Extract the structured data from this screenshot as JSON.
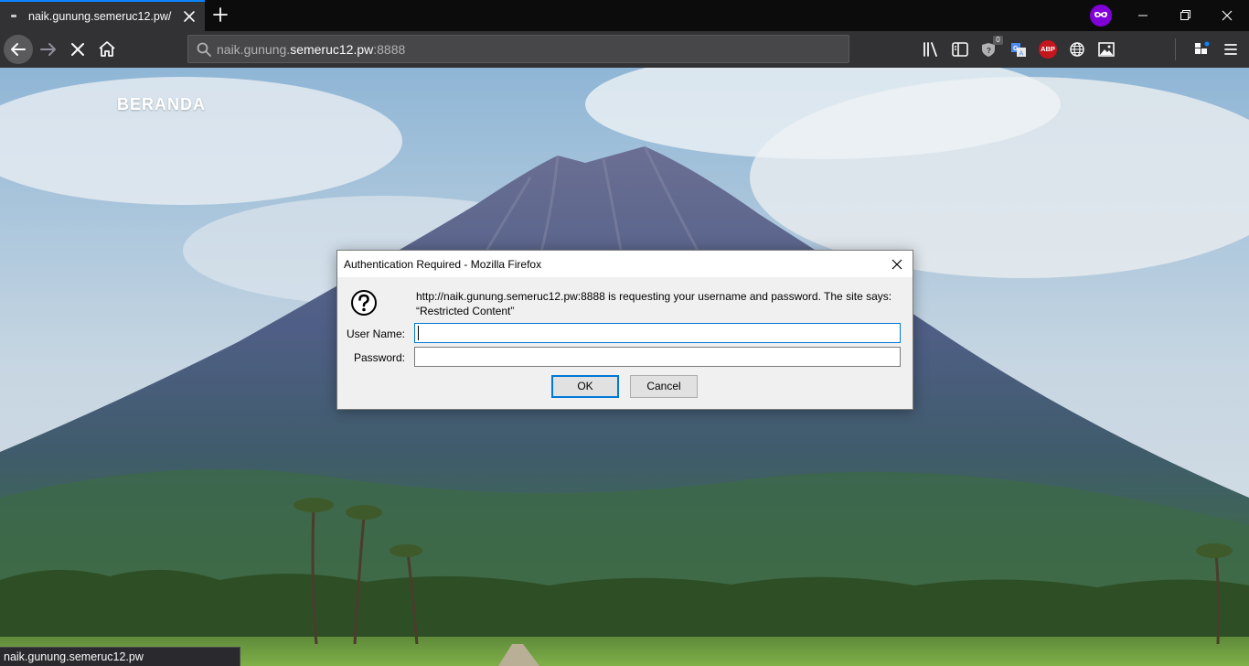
{
  "browser": {
    "tab_title": "naik.gunung.semeruc12.pw/",
    "url_prefix": "naik.gunung.",
    "url_domain": "semeruc12.pw",
    "url_port": ":8888",
    "shield_badge": "0",
    "abp_label": "ABP",
    "accent_color": "#0a84ff",
    "private_color": "#8000d7"
  },
  "page": {
    "nav_label": "BERANDA"
  },
  "status": {
    "text": "naik.gunung.semeruc12.pw"
  },
  "dialog": {
    "title": "Authentication Required - Mozilla Firefox",
    "message": "http://naik.gunung.semeruc12.pw:8888 is requesting your username and password. The site says: “Restricted Content”",
    "username_label": "User Name:",
    "password_label": "Password:",
    "username_value": "",
    "password_value": "",
    "ok_label": "OK",
    "cancel_label": "Cancel"
  }
}
